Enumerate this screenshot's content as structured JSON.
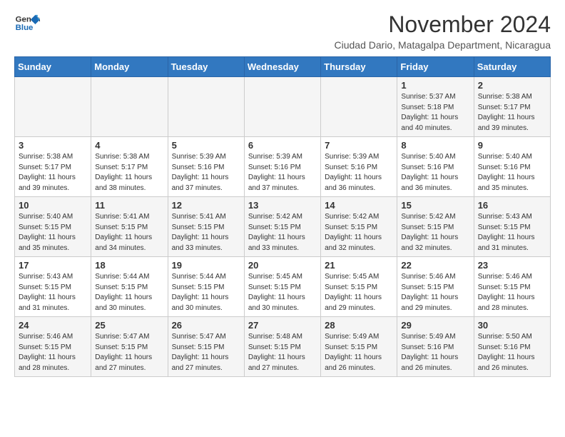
{
  "logo": {
    "line1": "General",
    "line2": "Blue"
  },
  "title": "November 2024",
  "subtitle": "Ciudad Dario, Matagalpa Department, Nicaragua",
  "headers": [
    "Sunday",
    "Monday",
    "Tuesday",
    "Wednesday",
    "Thursday",
    "Friday",
    "Saturday"
  ],
  "weeks": [
    [
      {
        "day": "",
        "info": ""
      },
      {
        "day": "",
        "info": ""
      },
      {
        "day": "",
        "info": ""
      },
      {
        "day": "",
        "info": ""
      },
      {
        "day": "",
        "info": ""
      },
      {
        "day": "1",
        "info": "Sunrise: 5:37 AM\nSunset: 5:18 PM\nDaylight: 11 hours\nand 40 minutes."
      },
      {
        "day": "2",
        "info": "Sunrise: 5:38 AM\nSunset: 5:17 PM\nDaylight: 11 hours\nand 39 minutes."
      }
    ],
    [
      {
        "day": "3",
        "info": "Sunrise: 5:38 AM\nSunset: 5:17 PM\nDaylight: 11 hours\nand 39 minutes."
      },
      {
        "day": "4",
        "info": "Sunrise: 5:38 AM\nSunset: 5:17 PM\nDaylight: 11 hours\nand 38 minutes."
      },
      {
        "day": "5",
        "info": "Sunrise: 5:39 AM\nSunset: 5:16 PM\nDaylight: 11 hours\nand 37 minutes."
      },
      {
        "day": "6",
        "info": "Sunrise: 5:39 AM\nSunset: 5:16 PM\nDaylight: 11 hours\nand 37 minutes."
      },
      {
        "day": "7",
        "info": "Sunrise: 5:39 AM\nSunset: 5:16 PM\nDaylight: 11 hours\nand 36 minutes."
      },
      {
        "day": "8",
        "info": "Sunrise: 5:40 AM\nSunset: 5:16 PM\nDaylight: 11 hours\nand 36 minutes."
      },
      {
        "day": "9",
        "info": "Sunrise: 5:40 AM\nSunset: 5:16 PM\nDaylight: 11 hours\nand 35 minutes."
      }
    ],
    [
      {
        "day": "10",
        "info": "Sunrise: 5:40 AM\nSunset: 5:15 PM\nDaylight: 11 hours\nand 35 minutes."
      },
      {
        "day": "11",
        "info": "Sunrise: 5:41 AM\nSunset: 5:15 PM\nDaylight: 11 hours\nand 34 minutes."
      },
      {
        "day": "12",
        "info": "Sunrise: 5:41 AM\nSunset: 5:15 PM\nDaylight: 11 hours\nand 33 minutes."
      },
      {
        "day": "13",
        "info": "Sunrise: 5:42 AM\nSunset: 5:15 PM\nDaylight: 11 hours\nand 33 minutes."
      },
      {
        "day": "14",
        "info": "Sunrise: 5:42 AM\nSunset: 5:15 PM\nDaylight: 11 hours\nand 32 minutes."
      },
      {
        "day": "15",
        "info": "Sunrise: 5:42 AM\nSunset: 5:15 PM\nDaylight: 11 hours\nand 32 minutes."
      },
      {
        "day": "16",
        "info": "Sunrise: 5:43 AM\nSunset: 5:15 PM\nDaylight: 11 hours\nand 31 minutes."
      }
    ],
    [
      {
        "day": "17",
        "info": "Sunrise: 5:43 AM\nSunset: 5:15 PM\nDaylight: 11 hours\nand 31 minutes."
      },
      {
        "day": "18",
        "info": "Sunrise: 5:44 AM\nSunset: 5:15 PM\nDaylight: 11 hours\nand 30 minutes."
      },
      {
        "day": "19",
        "info": "Sunrise: 5:44 AM\nSunset: 5:15 PM\nDaylight: 11 hours\nand 30 minutes."
      },
      {
        "day": "20",
        "info": "Sunrise: 5:45 AM\nSunset: 5:15 PM\nDaylight: 11 hours\nand 30 minutes."
      },
      {
        "day": "21",
        "info": "Sunrise: 5:45 AM\nSunset: 5:15 PM\nDaylight: 11 hours\nand 29 minutes."
      },
      {
        "day": "22",
        "info": "Sunrise: 5:46 AM\nSunset: 5:15 PM\nDaylight: 11 hours\nand 29 minutes."
      },
      {
        "day": "23",
        "info": "Sunrise: 5:46 AM\nSunset: 5:15 PM\nDaylight: 11 hours\nand 28 minutes."
      }
    ],
    [
      {
        "day": "24",
        "info": "Sunrise: 5:46 AM\nSunset: 5:15 PM\nDaylight: 11 hours\nand 28 minutes."
      },
      {
        "day": "25",
        "info": "Sunrise: 5:47 AM\nSunset: 5:15 PM\nDaylight: 11 hours\nand 27 minutes."
      },
      {
        "day": "26",
        "info": "Sunrise: 5:47 AM\nSunset: 5:15 PM\nDaylight: 11 hours\nand 27 minutes."
      },
      {
        "day": "27",
        "info": "Sunrise: 5:48 AM\nSunset: 5:15 PM\nDaylight: 11 hours\nand 27 minutes."
      },
      {
        "day": "28",
        "info": "Sunrise: 5:49 AM\nSunset: 5:15 PM\nDaylight: 11 hours\nand 26 minutes."
      },
      {
        "day": "29",
        "info": "Sunrise: 5:49 AM\nSunset: 5:16 PM\nDaylight: 11 hours\nand 26 minutes."
      },
      {
        "day": "30",
        "info": "Sunrise: 5:50 AM\nSunset: 5:16 PM\nDaylight: 11 hours\nand 26 minutes."
      }
    ]
  ]
}
